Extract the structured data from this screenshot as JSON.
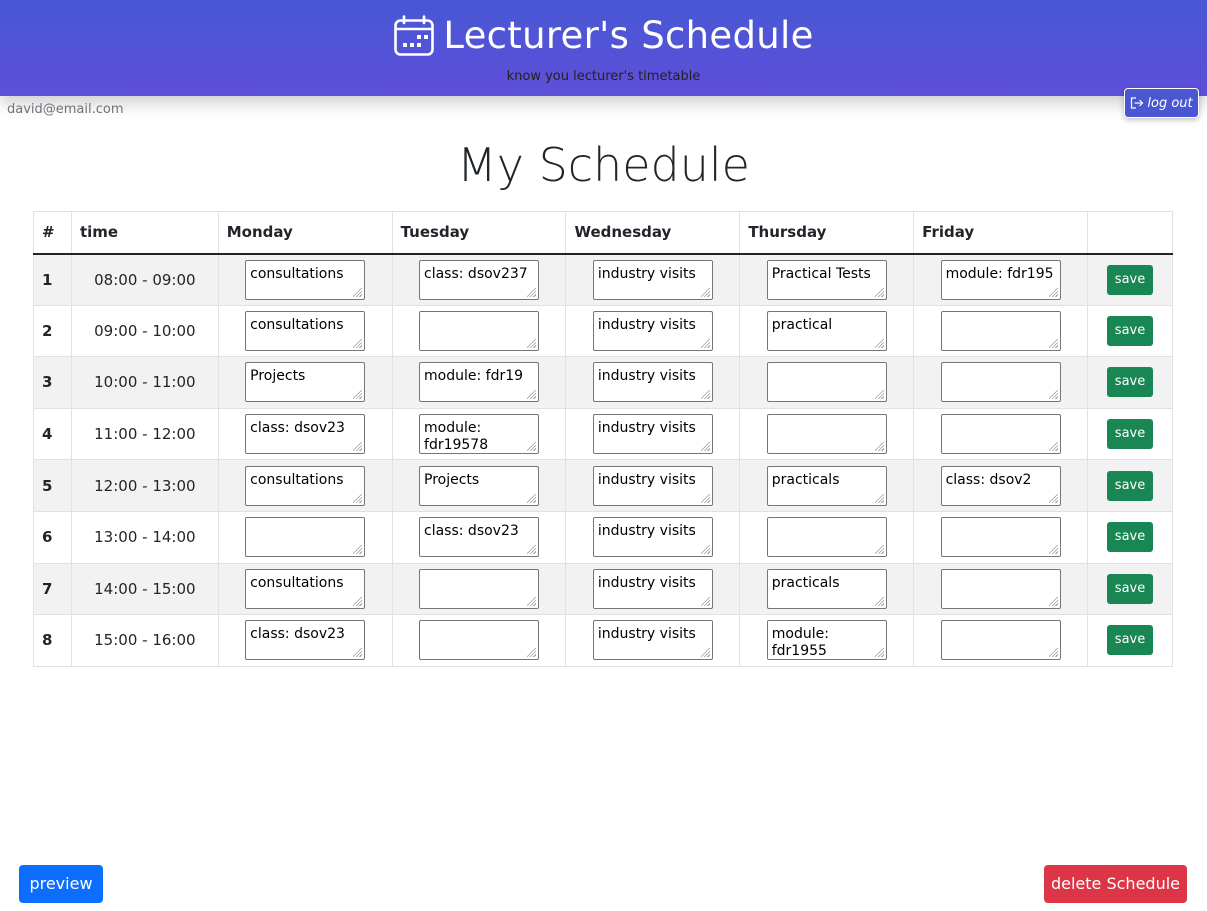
{
  "header": {
    "title": "Lecturer's Schedule",
    "subtitle": "know you lecturer's timetable",
    "icon": "calendar-icon"
  },
  "user": {
    "email": "david@email.com",
    "logout_label": "log out"
  },
  "page_title": "My Schedule",
  "table": {
    "columns": [
      "#",
      "time",
      "Monday",
      "Tuesday",
      "Wednesday",
      "Thursday",
      "Friday",
      ""
    ],
    "save_label": "save",
    "rows": [
      {
        "num": "1",
        "time": "08:00 - 09:00",
        "cells": [
          "consultations",
          "class: dsov237",
          "industry visits",
          "Practical Tests",
          "module: fdr195"
        ]
      },
      {
        "num": "2",
        "time": "09:00 - 10:00",
        "cells": [
          "consultations",
          "",
          "industry visits",
          "practical",
          ""
        ]
      },
      {
        "num": "3",
        "time": "10:00 - 11:00",
        "cells": [
          "Projects",
          "module: fdr19",
          "industry visits",
          "",
          ""
        ]
      },
      {
        "num": "4",
        "time": "11:00 - 12:00",
        "cells": [
          "class: dsov23",
          "module: fdr19578",
          "industry visits",
          "",
          ""
        ]
      },
      {
        "num": "5",
        "time": "12:00 - 13:00",
        "cells": [
          "consultations",
          "Projects",
          "industry visits",
          "practicals",
          "class: dsov2"
        ]
      },
      {
        "num": "6",
        "time": "13:00 - 14:00",
        "cells": [
          "",
          "class: dsov23",
          "industry visits",
          "",
          ""
        ]
      },
      {
        "num": "7",
        "time": "14:00 - 15:00",
        "cells": [
          "consultations",
          "",
          "industry visits",
          "practicals",
          ""
        ]
      },
      {
        "num": "8",
        "time": "15:00 - 16:00",
        "cells": [
          "class: dsov23",
          "",
          "industry visits",
          "module: fdr1955",
          ""
        ]
      }
    ]
  },
  "footer": {
    "preview_label": "preview",
    "delete_label": "delete Schedule"
  },
  "colors": {
    "header_gradient_top": "#4758d4",
    "header_gradient_bottom": "#5f4fd9",
    "save_button": "#198754",
    "preview_button": "#0d6efd",
    "delete_button": "#dc3545"
  }
}
